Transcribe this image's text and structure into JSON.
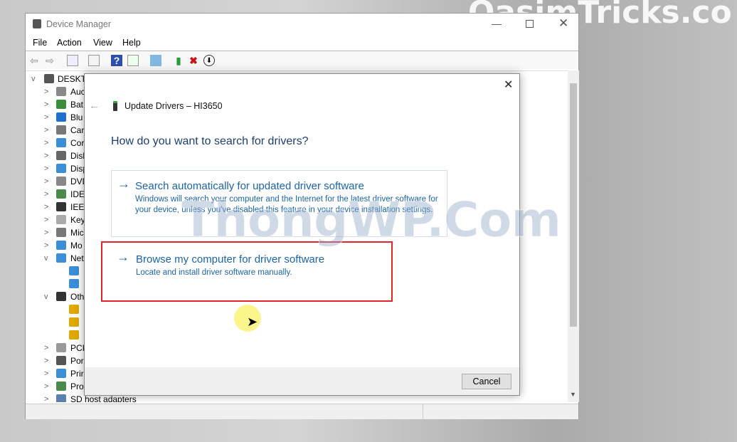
{
  "watermarks": {
    "top": "QasimTricks.co",
    "middle": "ThongWP.Com"
  },
  "window": {
    "title": "Device Manager",
    "menu": [
      "File",
      "Action",
      "View",
      "Help"
    ],
    "toolbar_icons": [
      "back-icon",
      "forward-icon",
      "show-hide-tree-icon",
      "properties-icon",
      "help-icon",
      "show-pane-icon",
      "scan-hardware-icon",
      "update-driver-icon",
      "uninstall-icon",
      "disable-icon"
    ]
  },
  "tree": {
    "root": "DESKTC",
    "items": [
      {
        "label": "Auc",
        "exp": ">",
        "icon": "#888"
      },
      {
        "label": "Bat",
        "exp": ">",
        "icon": "#3a8d3a"
      },
      {
        "label": "Blu",
        "exp": ">",
        "icon": "#1f6fd1"
      },
      {
        "label": "Car",
        "exp": ">",
        "icon": "#777"
      },
      {
        "label": "Cor",
        "exp": ">",
        "icon": "#3a8fd8"
      },
      {
        "label": "Disl",
        "exp": ">",
        "icon": "#666"
      },
      {
        "label": "Disp",
        "exp": ">",
        "icon": "#3a8fd8"
      },
      {
        "label": "DVD",
        "exp": ">",
        "icon": "#888"
      },
      {
        "label": "IDE",
        "exp": ">",
        "icon": "#4a8a4a"
      },
      {
        "label": "IEEE",
        "exp": ">",
        "icon": "#333"
      },
      {
        "label": "Key",
        "exp": ">",
        "icon": "#aaa"
      },
      {
        "label": "Mic",
        "exp": ">",
        "icon": "#777"
      },
      {
        "label": "Mo",
        "exp": ">",
        "icon": "#3a8fd8"
      },
      {
        "label": "Net",
        "exp": "v",
        "icon": "#3a8fd8"
      },
      {
        "label": "",
        "exp": "",
        "icon": "#3a8fd8",
        "child": true
      },
      {
        "label": "",
        "exp": "",
        "icon": "#3a8fd8",
        "child": true
      },
      {
        "label": "Oth",
        "exp": "v",
        "icon": "#333"
      },
      {
        "label": "",
        "exp": "",
        "icon": "#e0a800",
        "child": true
      },
      {
        "label": "",
        "exp": "",
        "icon": "#e0a800",
        "child": true
      },
      {
        "label": "",
        "exp": "",
        "icon": "#e0a800",
        "child": true
      },
      {
        "label": "PCI",
        "exp": ">",
        "icon": "#999"
      },
      {
        "label": "Por",
        "exp": ">",
        "icon": "#555"
      },
      {
        "label": "Prir",
        "exp": ">",
        "icon": "#3a8fd8"
      },
      {
        "label": "Pro",
        "exp": ">",
        "icon": "#4a8a4a"
      },
      {
        "label": "SD host adapters",
        "exp": ">",
        "icon": "#5a7fb0"
      }
    ]
  },
  "dialog": {
    "title": "Update Drivers – HI3650",
    "heading": "How do you want to search for drivers?",
    "option1": {
      "title": "Search automatically for updated driver software",
      "desc": "Windows will search your computer and the Internet for the latest driver software for your device, unless you've disabled this feature in your device installation settings."
    },
    "option2": {
      "title": "Browse my computer for driver software",
      "desc": "Locate and install driver software manually."
    },
    "cancel": "Cancel"
  },
  "colors": {
    "link": "#1b64a8",
    "highlight_box": "#e0252b"
  }
}
